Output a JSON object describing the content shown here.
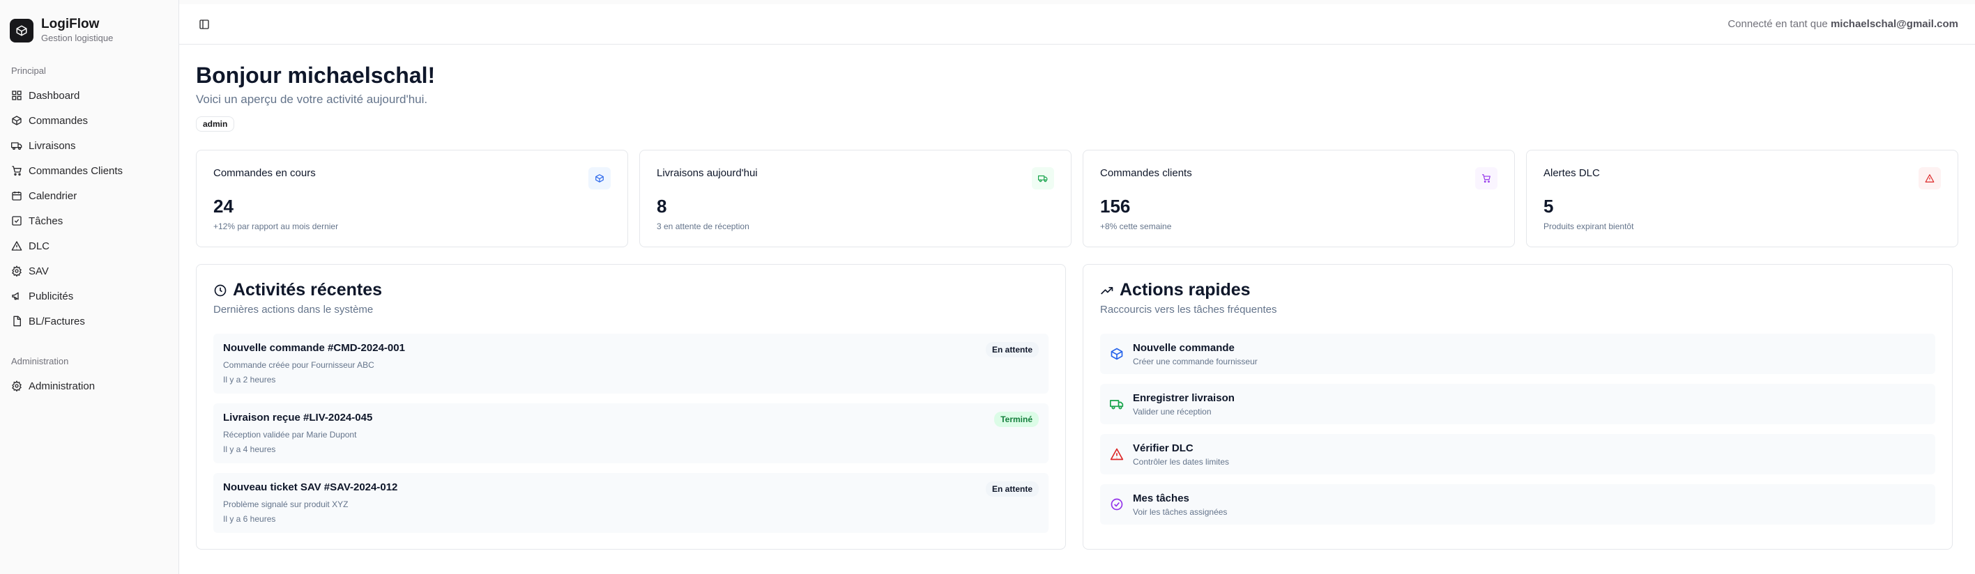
{
  "brand": {
    "name": "LogiFlow",
    "subtitle": "Gestion logistique"
  },
  "sidebar": {
    "section_main": "Principal",
    "items": [
      {
        "label": "Dashboard",
        "icon": "grid-icon"
      },
      {
        "label": "Commandes",
        "icon": "package-icon"
      },
      {
        "label": "Livraisons",
        "icon": "truck-icon"
      },
      {
        "label": "Commandes Clients",
        "icon": "cart-icon"
      },
      {
        "label": "Calendrier",
        "icon": "calendar-icon"
      },
      {
        "label": "Tâches",
        "icon": "check-square-icon"
      },
      {
        "label": "DLC",
        "icon": "alert-triangle-icon"
      },
      {
        "label": "SAV",
        "icon": "settings-icon"
      },
      {
        "label": "Publicités",
        "icon": "megaphone-icon"
      },
      {
        "label": "BL/Factures",
        "icon": "file-icon"
      }
    ],
    "section_admin": "Administration",
    "admin_items": [
      {
        "label": "Administration",
        "icon": "settings-icon"
      }
    ]
  },
  "topbar": {
    "connected_prefix": "Connecté en tant que",
    "connected_email": "michaelschal@gmail.com"
  },
  "header": {
    "greeting": "Bonjour michaelschal!",
    "subtitle": "Voici un aperçu de votre activité aujourd'hui.",
    "role": "admin"
  },
  "stats": [
    {
      "title": "Commandes en cours",
      "value": "24",
      "note": "+12% par rapport au mois dernier",
      "icon": "package-icon",
      "color": "#2563eb",
      "bg": "#eff6ff"
    },
    {
      "title": "Livraisons aujourd'hui",
      "value": "8",
      "note": "3 en attente de réception",
      "icon": "truck-icon",
      "color": "#16a34a",
      "bg": "#f0fdf4"
    },
    {
      "title": "Commandes clients",
      "value": "156",
      "note": "+8% cette semaine",
      "icon": "cart-icon",
      "color": "#9333ea",
      "bg": "#faf5ff"
    },
    {
      "title": "Alertes DLC",
      "value": "5",
      "note": "Produits expirant bientôt",
      "icon": "alert-triangle-icon",
      "color": "#dc2626",
      "bg": "#fef2f2"
    }
  ],
  "activities": {
    "title": "Activités récentes",
    "subtitle": "Dernières actions dans le système",
    "items": [
      {
        "title": "Nouvelle commande #CMD-2024-001",
        "desc": "Commande créée pour Fournisseur ABC",
        "time": "Il y a 2 heures",
        "badge": "En attente",
        "status": "pending"
      },
      {
        "title": "Livraison reçue #LIV-2024-045",
        "desc": "Réception validée par Marie Dupont",
        "time": "Il y a 4 heures",
        "badge": "Terminé",
        "status": "done"
      },
      {
        "title": "Nouveau ticket SAV #SAV-2024-012",
        "desc": "Problème signalé sur produit XYZ",
        "time": "Il y a 6 heures",
        "badge": "En attente",
        "status": "pending"
      }
    ]
  },
  "quick_actions": {
    "title": "Actions rapides",
    "subtitle": "Raccourcis vers les tâches fréquentes",
    "items": [
      {
        "title": "Nouvelle commande",
        "desc": "Créer une commande fournisseur",
        "icon": "package-icon",
        "color": "#2563eb"
      },
      {
        "title": "Enregistrer livraison",
        "desc": "Valider une réception",
        "icon": "truck-icon",
        "color": "#16a34a"
      },
      {
        "title": "Vérifier DLC",
        "desc": "Contrôler les dates limites",
        "icon": "alert-triangle-icon",
        "color": "#dc2626"
      },
      {
        "title": "Mes tâches",
        "desc": "Voir les tâches assignées",
        "icon": "check-circle-icon",
        "color": "#9333ea"
      }
    ]
  }
}
